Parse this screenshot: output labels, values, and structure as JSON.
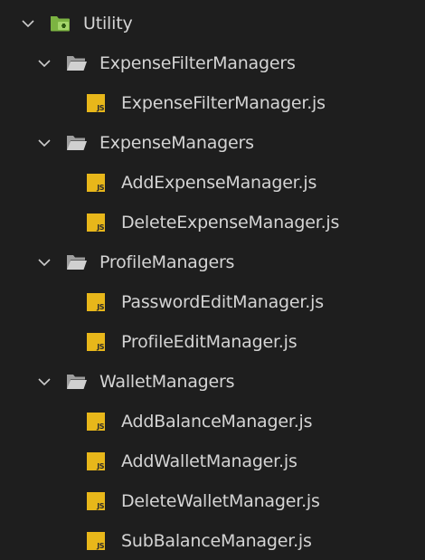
{
  "explorer": {
    "root": {
      "label": "Utility",
      "icon": "folder-open-icon",
      "accent": "#7cb342",
      "folders": [
        {
          "label": "ExpenseFilterManagers",
          "files": [
            "ExpenseFilterManager.js"
          ]
        },
        {
          "label": "ExpenseManagers",
          "files": [
            "AddExpenseManager.js",
            "DeleteExpenseManager.js"
          ]
        },
        {
          "label": "ProfileManagers",
          "files": [
            "PasswordEditManager.js",
            "ProfileEditManager.js"
          ]
        },
        {
          "label": "WalletManagers",
          "files": [
            "AddBalanceManager.js",
            "AddWalletManager.js",
            "DeleteWalletManager.js",
            "SubBalanceManager.js"
          ]
        }
      ]
    },
    "js_badge": "JS",
    "colors": {
      "background": "#1e1e1e",
      "text": "#d4d4d4",
      "folder": "#c5c5c5",
      "js_icon": "#e8b71a"
    }
  }
}
